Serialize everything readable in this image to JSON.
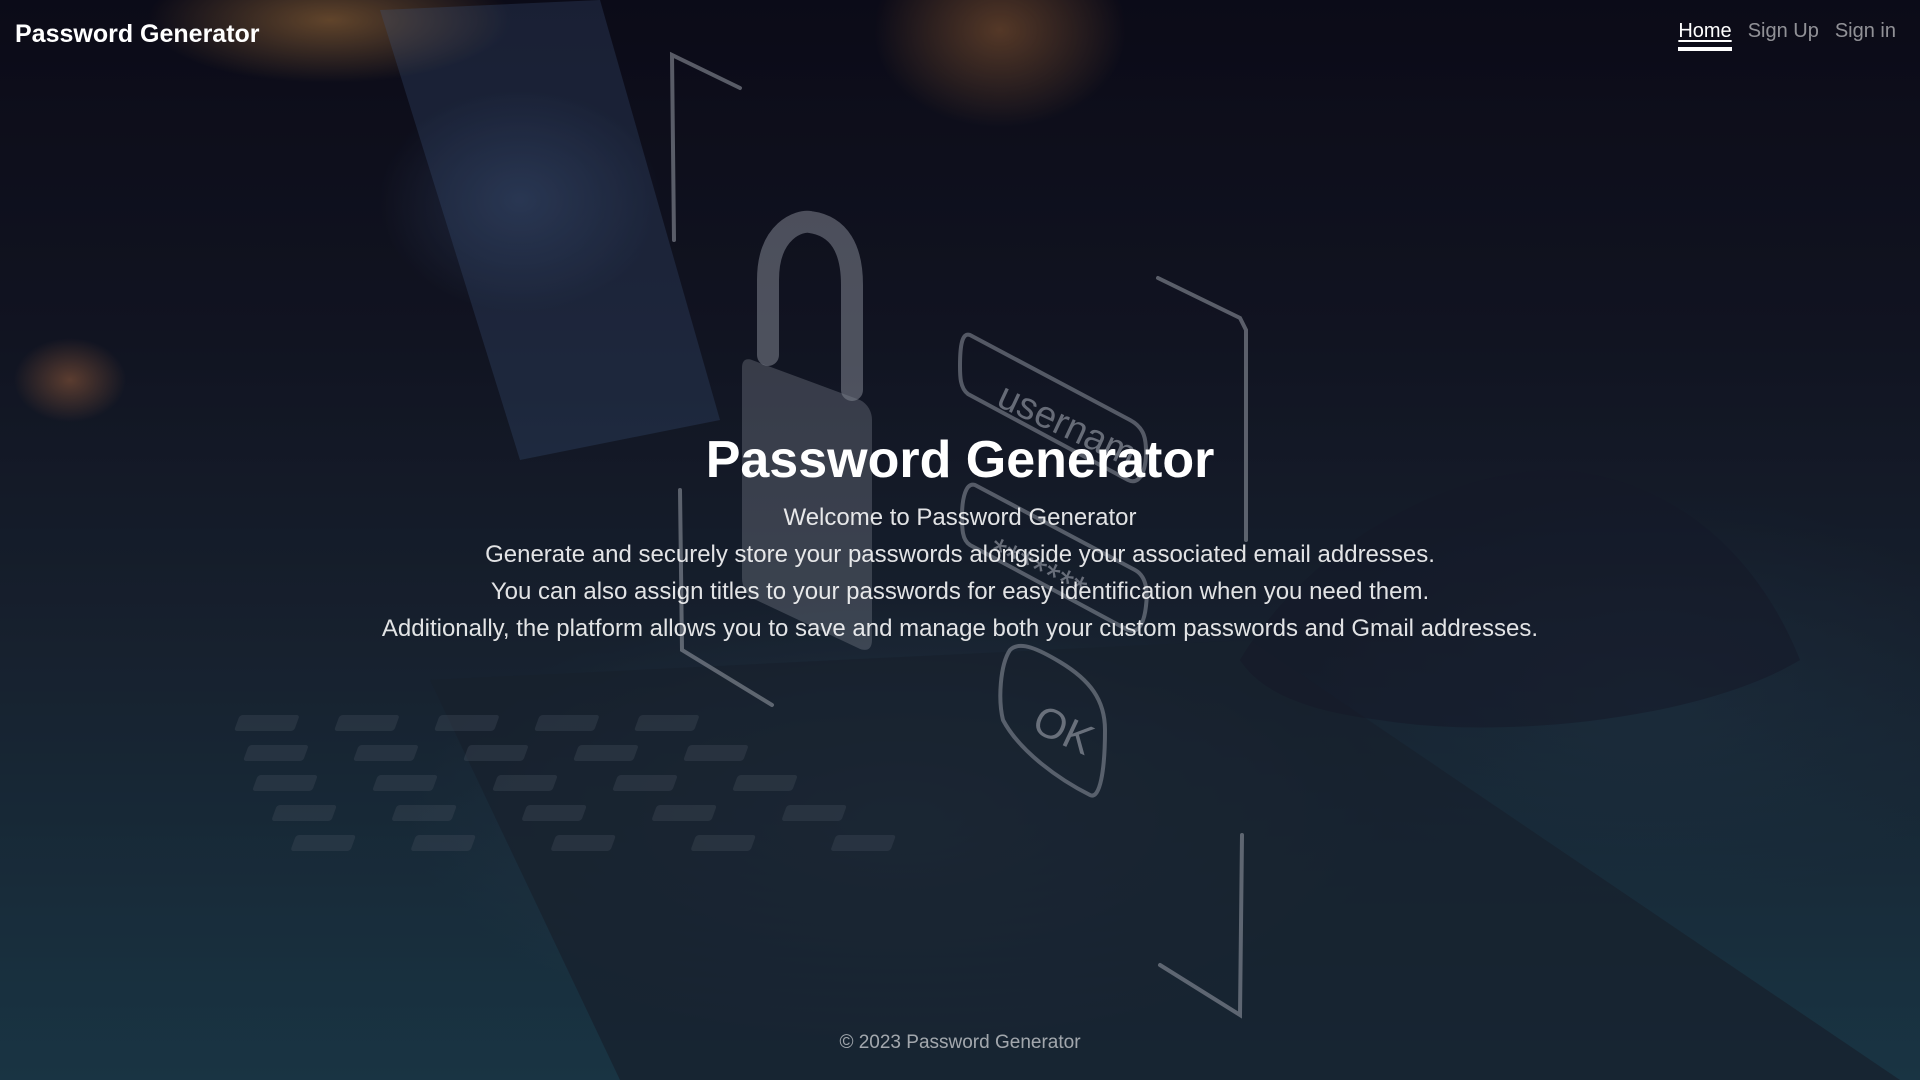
{
  "navbar": {
    "brand": "Password Generator",
    "links": [
      {
        "label": "Home",
        "active": true
      },
      {
        "label": "Sign Up",
        "active": false
      },
      {
        "label": "Sign in",
        "active": false
      }
    ]
  },
  "hero": {
    "title": "Password Generator",
    "welcome": "Welcome to Password Generator",
    "lines": [
      "Generate and securely store your passwords alongside your associated email addresses.",
      "You can also assign titles to your passwords for easy identification when you need them.",
      "Additionally, the platform allows you to save and manage both your custom passwords and Gmail addresses."
    ]
  },
  "background": {
    "field_username": "usernam",
    "field_password": "*******",
    "field_ok": "OK"
  },
  "footer": {
    "copyright": "© 2023 Password Generator"
  }
}
